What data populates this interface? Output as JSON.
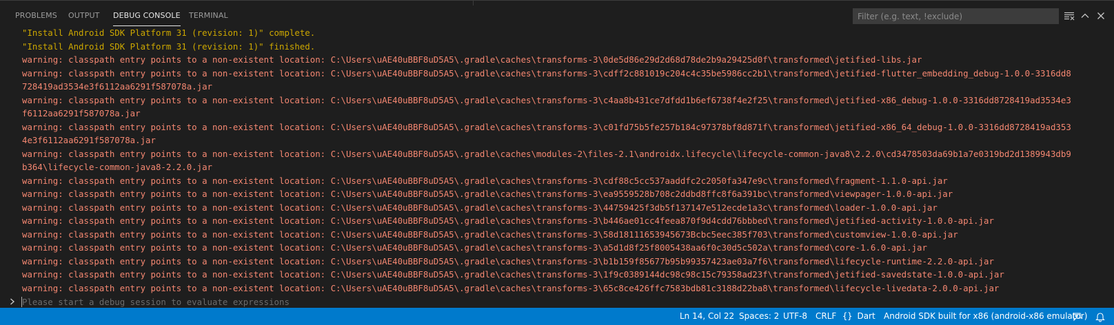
{
  "panel": {
    "tabs": [
      {
        "label": "PROBLEMS"
      },
      {
        "label": "OUTPUT"
      },
      {
        "label": "DEBUG CONSOLE"
      },
      {
        "label": "TERMINAL"
      }
    ],
    "active_tab": "DEBUG CONSOLE",
    "filter_placeholder": "Filter (e.g. text, !exclude)",
    "icons": [
      "clear-console-icon",
      "maximize-panel-icon",
      "close-panel-icon"
    ]
  },
  "console": {
    "lines": [
      {
        "kind": "status",
        "text": "\"Install Android SDK Platform 31 (revision: 1)\" complete."
      },
      {
        "kind": "status",
        "text": "\"Install Android SDK Platform 31 (revision: 1)\" finished."
      },
      {
        "kind": "warn",
        "text": "warning: classpath entry points to a non-existent location: C:\\Users\\uAE40uBBF8uD5A5\\.gradle\\caches\\transforms-3\\0de5d86e29d2d68d78de2b9a29425d0f\\transformed\\jetified-libs.jar"
      },
      {
        "kind": "warn",
        "text": "warning: classpath entry points to a non-existent location: C:\\Users\\uAE40uBBF8uD5A5\\.gradle\\caches\\transforms-3\\cdff2c881019c204c4c35be5986cc2b1\\transformed\\jetified-flutter_embedding_debug-1.0.0-3316dd8"
      },
      {
        "kind": "warn",
        "text": "728419ad3534e3f6112aa6291f587078a.jar"
      },
      {
        "kind": "warn",
        "text": "warning: classpath entry points to a non-existent location: C:\\Users\\uAE40uBBF8uD5A5\\.gradle\\caches\\transforms-3\\c4aa8b431ce7dfdd1b6ef6738f4e2f25\\transformed\\jetified-x86_debug-1.0.0-3316dd8728419ad3534e3"
      },
      {
        "kind": "warn",
        "text": "f6112aa6291f587078a.jar"
      },
      {
        "kind": "warn",
        "text": "warning: classpath entry points to a non-existent location: C:\\Users\\uAE40uBBF8uD5A5\\.gradle\\caches\\transforms-3\\c01fd75b5fe257b184c97378bf8d871f\\transformed\\jetified-x86_64_debug-1.0.0-3316dd8728419ad353"
      },
      {
        "kind": "warn",
        "text": "4e3f6112aa6291f587078a.jar"
      },
      {
        "kind": "warn",
        "text": "warning: classpath entry points to a non-existent location: C:\\Users\\uAE40uBBF8uD5A5\\.gradle\\caches\\modules-2\\files-2.1\\androidx.lifecycle\\lifecycle-common-java8\\2.2.0\\cd3478503da69b1a7e0319bd2d1389943db9"
      },
      {
        "kind": "warn",
        "text": "b364\\lifecycle-common-java8-2.2.0.jar"
      },
      {
        "kind": "warn",
        "text": "warning: classpath entry points to a non-existent location: C:\\Users\\uAE40uBBF8uD5A5\\.gradle\\caches\\transforms-3\\cdf88c5cc537aaddfc2c2050fa347e9c\\transformed\\fragment-1.1.0-api.jar"
      },
      {
        "kind": "warn",
        "text": "warning: classpath entry points to a non-existent location: C:\\Users\\uAE40uBBF8uD5A5\\.gradle\\caches\\transforms-3\\ea9559528b708c2ddbd8ffc8f6a391bc\\transformed\\viewpager-1.0.0-api.jar"
      },
      {
        "kind": "warn",
        "text": "warning: classpath entry points to a non-existent location: C:\\Users\\uAE40uBBF8uD5A5\\.gradle\\caches\\transforms-3\\44759425f3db5f137147e512ecde1a3c\\transformed\\loader-1.0.0-api.jar"
      },
      {
        "kind": "warn",
        "text": "warning: classpath entry points to a non-existent location: C:\\Users\\uAE40uBBF8uD5A5\\.gradle\\caches\\transforms-3\\b446ae01cc4feea870f9d4cdd76bbbed\\transformed\\jetified-activity-1.0.0-api.jar"
      },
      {
        "kind": "warn",
        "text": "warning: classpath entry points to a non-existent location: C:\\Users\\uAE40uBBF8uD5A5\\.gradle\\caches\\transforms-3\\58d18111653945673Bcbc5eec385f703\\transformed\\customview-1.0.0-api.jar"
      },
      {
        "kind": "warn",
        "text": "warning: classpath entry points to a non-existent location: C:\\Users\\uAE40uBBF8uD5A5\\.gradle\\caches\\transforms-3\\a5d1d8f25f8005438aa6f0c30d5c502a\\transformed\\core-1.6.0-api.jar"
      },
      {
        "kind": "warn",
        "text": "warning: classpath entry points to a non-existent location: C:\\Users\\uAE40uBBF8uD5A5\\.gradle\\caches\\transforms-3\\b1b159f85677b95b99357423ae03a7f6\\transformed\\lifecycle-runtime-2.2.0-api.jar"
      },
      {
        "kind": "warn",
        "text": "warning: classpath entry points to a non-existent location: C:\\Users\\uAE40uBBF8uD5A5\\.gradle\\caches\\transforms-3\\1f9c0389144dc98c98c15c79358ad23f\\transformed\\jetified-savedstate-1.0.0-api.jar"
      },
      {
        "kind": "warn",
        "text": "warning: classpath entry points to a non-existent location: C:\\Users\\uAE40uBBF8uD5A5\\.gradle\\caches\\transforms-3\\65c8ce426ffc7583bdb81c3188d22ba8\\transformed\\lifecycle-livedata-2.0.0-api.jar"
      }
    ],
    "input_placeholder": "Please start a debug session to evaluate expressions"
  },
  "statusbar": {
    "position": "Ln 14, Col 22",
    "spaces": "Spaces: 2",
    "encoding": "UTF-8",
    "eol": "CRLF",
    "language_icon": "{}",
    "language": "Dart",
    "device": "Android SDK built for x86 (android-x86 emulator)",
    "right_icons": [
      "feedback-icon",
      "notifications-bell-icon"
    ]
  },
  "colors": {
    "background": "#1e1e1e",
    "statusbar": "#007acc",
    "warning_text": "#f48771",
    "status_text": "#cca700",
    "tab_active": "#e7e7e7",
    "tab_inactive": "#9d9d9d"
  }
}
